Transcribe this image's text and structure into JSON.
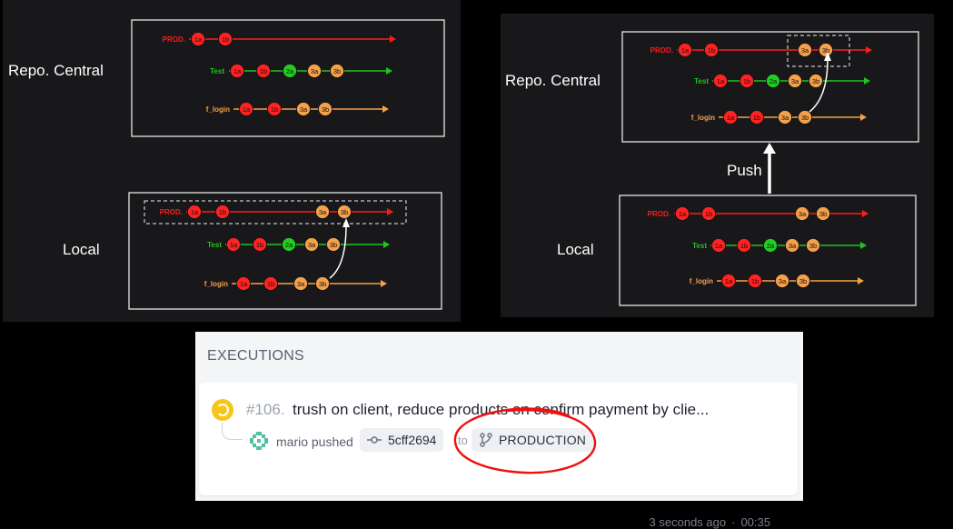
{
  "diagrams": {
    "left": {
      "repo_label": "Repo. Central",
      "local_label": "Local",
      "repo_branches": [
        {
          "name": "PROD.",
          "commits": [
            "1a",
            "1b"
          ]
        },
        {
          "name": "Test",
          "commits": [
            "1a",
            "1b",
            "2a",
            "3a",
            "3b"
          ]
        },
        {
          "name": "f_login",
          "commits": [
            "1a",
            "1b",
            "3a",
            "3b"
          ]
        }
      ],
      "local_branches": [
        {
          "name": "PROD.",
          "commits": [
            "1a",
            "1b",
            "3a",
            "3b"
          ]
        },
        {
          "name": "Test",
          "commits": [
            "1a",
            "1b",
            "2a",
            "3a",
            "3b"
          ]
        },
        {
          "name": "f_login",
          "commits": [
            "1a",
            "1b",
            "3a",
            "3b"
          ]
        }
      ]
    },
    "right": {
      "repo_label": "Repo. Central",
      "push_label": "Push",
      "local_label": "Local",
      "repo_branches": [
        {
          "name": "PROD.",
          "commits": [
            "1a",
            "1b",
            "3a",
            "3b"
          ]
        },
        {
          "name": "Test",
          "commits": [
            "1a",
            "1b",
            "2a",
            "3a",
            "3b"
          ]
        },
        {
          "name": "f_login",
          "commits": [
            "1a",
            "1b",
            "3a",
            "3b"
          ]
        }
      ],
      "local_branches": [
        {
          "name": "PROD.",
          "commits": [
            "1a",
            "1b",
            "3a",
            "3b"
          ]
        },
        {
          "name": "Test",
          "commits": [
            "1a",
            "1b",
            "2a",
            "3a",
            "3b"
          ]
        },
        {
          "name": "f_login",
          "commits": [
            "1a",
            "1b",
            "3a",
            "3b"
          ]
        }
      ]
    },
    "colors": {
      "prod": "#ff1a1a",
      "test": "#1fc41f",
      "flogin": "#f5a04a",
      "commit_red": "#ff2222",
      "commit_green": "#22cc22",
      "commit_orange": "#f5a04a"
    }
  },
  "executions": {
    "header": "EXECUTIONS",
    "item": {
      "number": "#106.",
      "message": "trush on client, reduce products on confirm payment by clie...",
      "pusher_text": "mario pushed",
      "commit_hash": "5cff2694",
      "to_text": "to",
      "branch": "PRODUCTION",
      "time_ago": "3 seconds ago",
      "separator": "·",
      "duration": "00:35",
      "status_color": "#f5c518"
    }
  }
}
